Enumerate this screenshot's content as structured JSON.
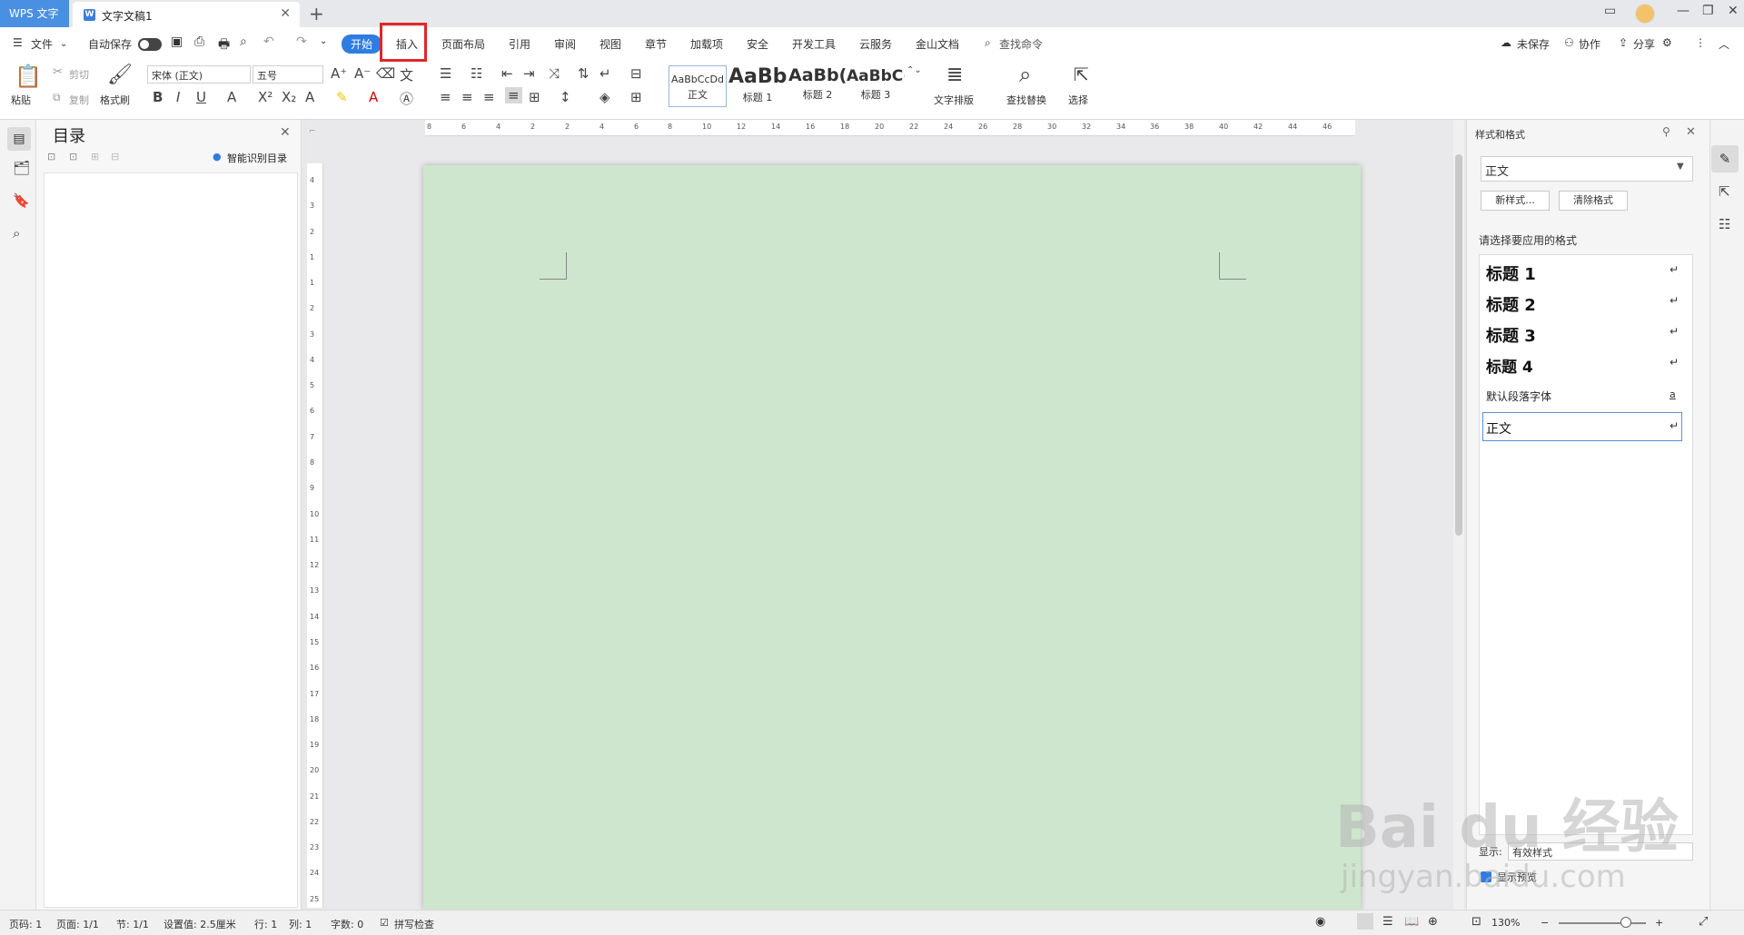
{
  "titlebar": {
    "app_tab": "WPS 文字",
    "doc_tab": "文字文稿1",
    "new_tab": "+",
    "doc_icon": "W"
  },
  "menubar": {
    "file": "文件",
    "autosave": "自动保存",
    "tabs": [
      "开始",
      "插入",
      "页面布局",
      "引用",
      "审阅",
      "视图",
      "章节",
      "加载项",
      "安全",
      "开发工具",
      "云服务",
      "金山文档"
    ],
    "search_command": "查找命令",
    "unsaved": "未保存",
    "collaborate": "协作",
    "share": "分享"
  },
  "ribbon": {
    "paste": "粘贴",
    "cut": "剪切",
    "copy": "复制",
    "format_painter": "格式刷",
    "font_name": "宋体 (正文)",
    "font_size": "五号",
    "styles": [
      {
        "preview": "AaBbCcDd",
        "caption": "正文"
      },
      {
        "preview": "AaBb",
        "caption": "标题 1"
      },
      {
        "preview": "AaBb(",
        "caption": "标题 2"
      },
      {
        "preview": "AaBbC(",
        "caption": "标题 3"
      }
    ],
    "text_layout": "文字排版",
    "find_replace": "查找替换",
    "select": "选择"
  },
  "toc": {
    "title": "目录",
    "smart_toc": "智能识别目录"
  },
  "ruler": {
    "h_ticks": [
      "8",
      "6",
      "4",
      "2",
      "2",
      "4",
      "6",
      "8",
      "10",
      "12",
      "14",
      "16",
      "18",
      "20",
      "22",
      "24",
      "26",
      "28",
      "30",
      "32",
      "34",
      "36",
      "38",
      "40",
      "42",
      "44",
      "46"
    ],
    "v_ticks": [
      "4",
      "3",
      "2",
      "1",
      "1",
      "2",
      "3",
      "4",
      "5",
      "6",
      "7",
      "8",
      "9",
      "10",
      "11",
      "12",
      "13",
      "14",
      "15",
      "16",
      "17",
      "18",
      "19",
      "20",
      "21",
      "22",
      "23",
      "24",
      "25"
    ]
  },
  "styles_panel": {
    "title": "样式和格式",
    "current_style": "正文",
    "new_style": "新样式...",
    "clear_format": "清除格式",
    "prompt": "请选择要应用的格式",
    "items": [
      {
        "label": "标题  1",
        "mark": "↵"
      },
      {
        "label": "标题  2",
        "mark": "↵"
      },
      {
        "label": "标题  3",
        "mark": "↵"
      },
      {
        "label": "标题  4",
        "mark": "↵"
      },
      {
        "label": "默认段落字体",
        "mark": "a"
      },
      {
        "label": "正文",
        "mark": "↵"
      }
    ],
    "show_label": "显示:",
    "show_value": "有效样式",
    "preview_label": "显示预览"
  },
  "statusbar": {
    "page_num": "页码: 1",
    "pages": "页面: 1/1",
    "section": "节: 1/1",
    "setting": "设置值: 2.5厘米",
    "row": "行: 1",
    "col": "列: 1",
    "words": "字数: 0",
    "spell": "拼写检查",
    "zoom": "130%"
  },
  "watermark": {
    "line1": "Bai du 经验",
    "line2": "jingyan.baidu.com"
  },
  "colors": {
    "accent": "#2f7de1",
    "page": "#cde6cd",
    "highlight_box": "#e0262a"
  }
}
